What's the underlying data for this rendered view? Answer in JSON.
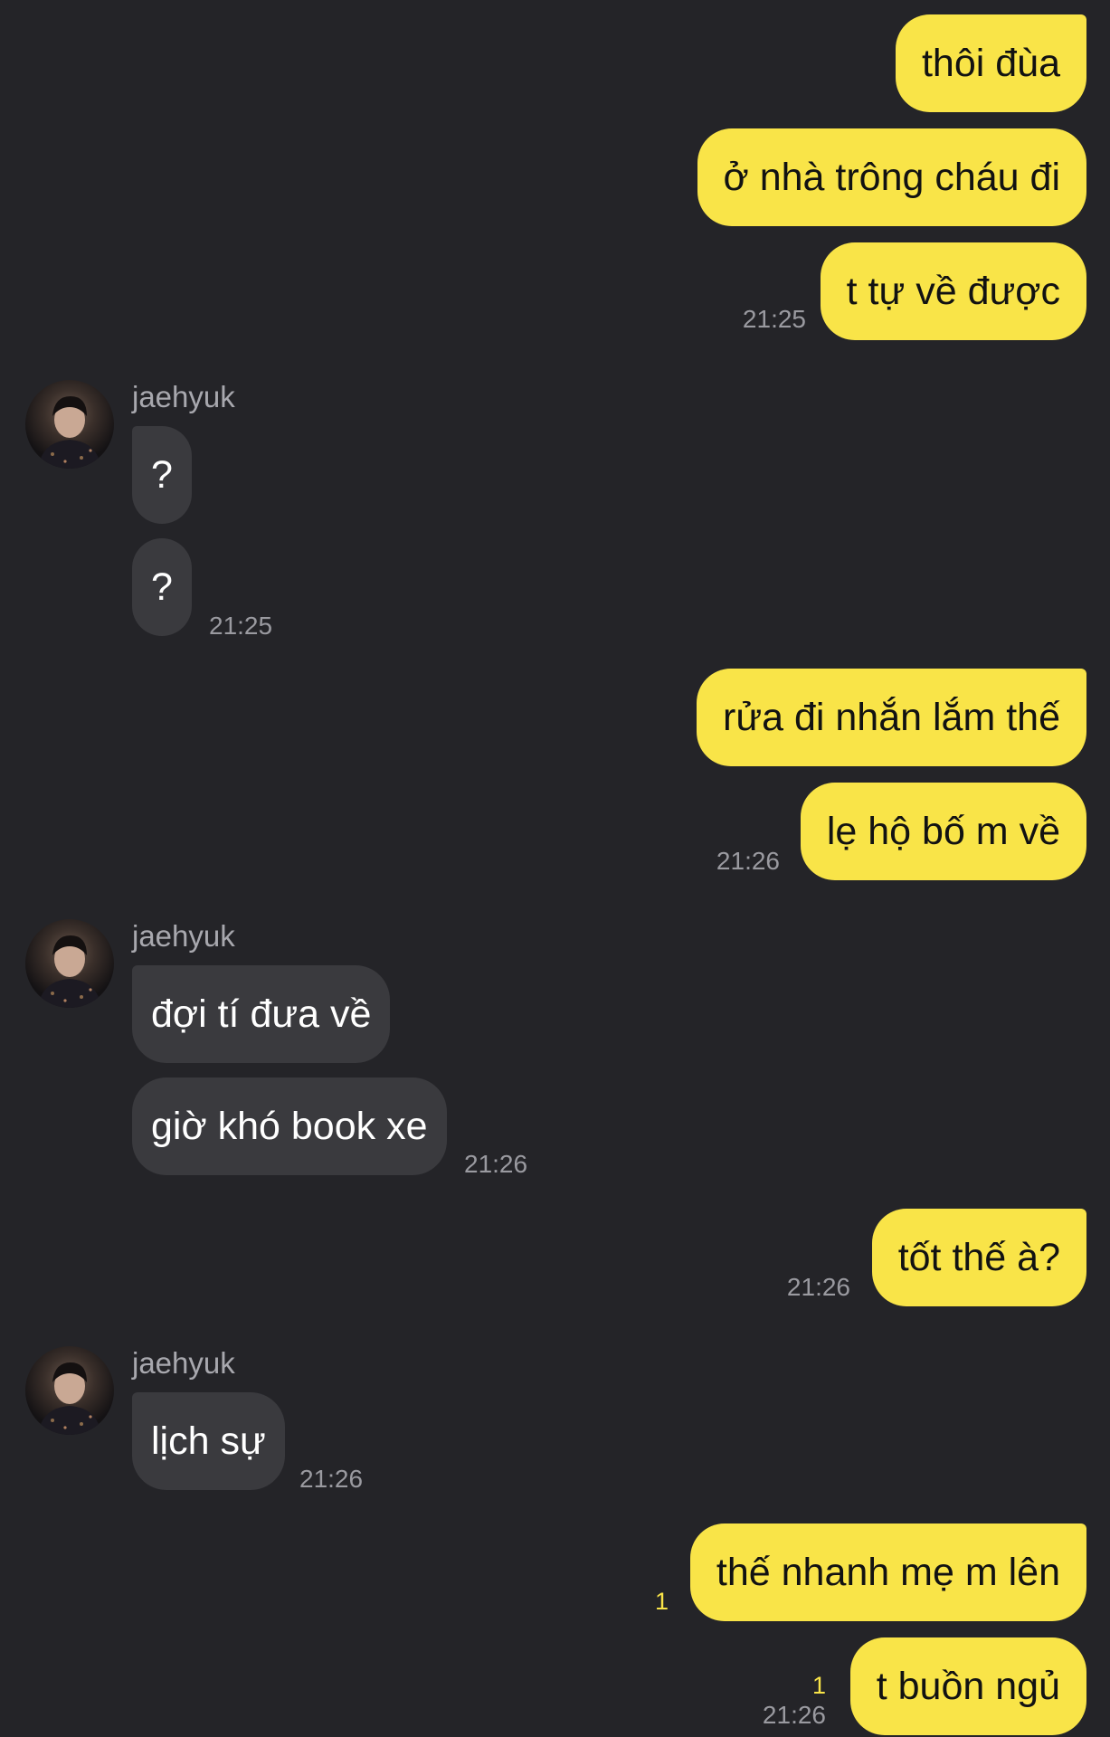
{
  "contact": {
    "name": "jaehyuk"
  },
  "colors": {
    "background": "#242428",
    "outgoing_bubble": "#f9e448",
    "incoming_bubble": "#3a3a3e",
    "unread": "#f9e448"
  },
  "messages": [
    {
      "direction": "out",
      "text": "thôi đùa"
    },
    {
      "direction": "out",
      "text": "ở nhà trông cháu đi"
    },
    {
      "direction": "out",
      "text": "t tự về được",
      "time": "21:25"
    },
    {
      "direction": "in",
      "text": "?"
    },
    {
      "direction": "in",
      "text": "?",
      "time": "21:25"
    },
    {
      "direction": "out",
      "text": "rửa đi nhắn lắm thế"
    },
    {
      "direction": "out",
      "text": "lẹ hộ bố m về",
      "time": "21:26"
    },
    {
      "direction": "in",
      "text": "đợi tí đưa về"
    },
    {
      "direction": "in",
      "text": "giờ khó book xe",
      "time": "21:26"
    },
    {
      "direction": "out",
      "text": "tốt thế à?",
      "time": "21:26"
    },
    {
      "direction": "in",
      "text": "lịch sự",
      "time": "21:26"
    },
    {
      "direction": "out",
      "text": "thế nhanh mẹ m lên",
      "unread": "1"
    },
    {
      "direction": "out",
      "text": "t buồn ngủ",
      "unread": "1",
      "time": "21:26"
    }
  ]
}
